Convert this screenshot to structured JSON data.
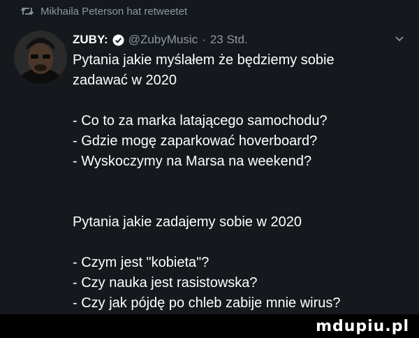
{
  "retweet": {
    "icon": "retweet-icon",
    "text": "Mikhaila Peterson hat retweetet"
  },
  "tweet": {
    "author": "ZUBY:",
    "verified_icon": "verified-badge-icon",
    "handle": "@ZubyMusic",
    "separator": "·",
    "time": "23 Std.",
    "menu_icon": "chevron-down-icon",
    "lines": [
      "Pytania jakie myślałem że będziemy sobie",
      "zadawać w 2020",
      "",
      "- Co to za marka latającego samochodu?",
      "- Gdzie mogę zaparkować hoverboard?",
      "- Wyskoczymy na Marsa na weekend?",
      "",
      "",
      "Pytania jakie zadajemy sobie w 2020",
      "",
      "- Czym jest \"kobieta\"?",
      "- Czy nauka jest rasistowska?",
      "- Czy jak pójdę po chleb zabije mnie wirus?"
    ]
  },
  "watermark": "mdupiu.pl",
  "colors": {
    "background": "#15181c",
    "secondary_text": "#8b98a5",
    "verified": "#ffffff",
    "footer": "#000000"
  }
}
